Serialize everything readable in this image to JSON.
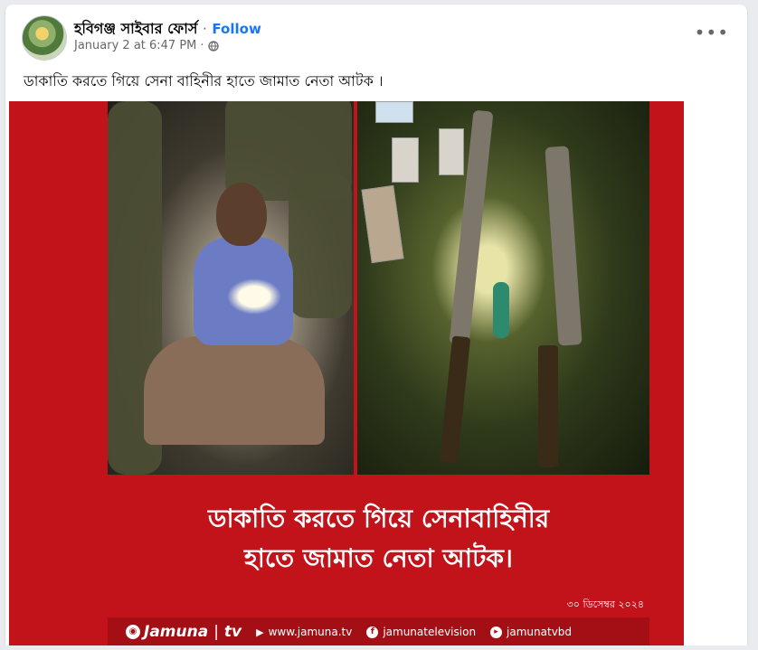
{
  "post": {
    "page_name": "হবিগঞ্জ সাইবার ফোর্স",
    "separator": "·",
    "follow_label": "Follow",
    "timestamp": "January 2 at 6:47 PM",
    "meta_sep": "·",
    "audience_icon": "globe-icon",
    "more_icon": "more-options-icon",
    "more_glyph": "•••",
    "text": "ডাকাতি করতে গিয়ে সেনা বাহিনীর হাতে জামাত নেতা আটক ।"
  },
  "media": {
    "headline_line1": "ডাকাতি করতে গিয়ে সেনাবাহিনীর",
    "headline_line2": "হাতে জামাত নেতা আটক।",
    "date": "৩০ ডিসেম্বর ২০২৪",
    "brand": "Jamuna",
    "brand_suffix": "tv",
    "website": "www.jamuna.tv",
    "facebook": "jamunatelevision",
    "youtube": "jamunatvbd",
    "colors": {
      "banner": "#c2121a",
      "footer": "#a40f15",
      "link": "#1877f2"
    }
  }
}
